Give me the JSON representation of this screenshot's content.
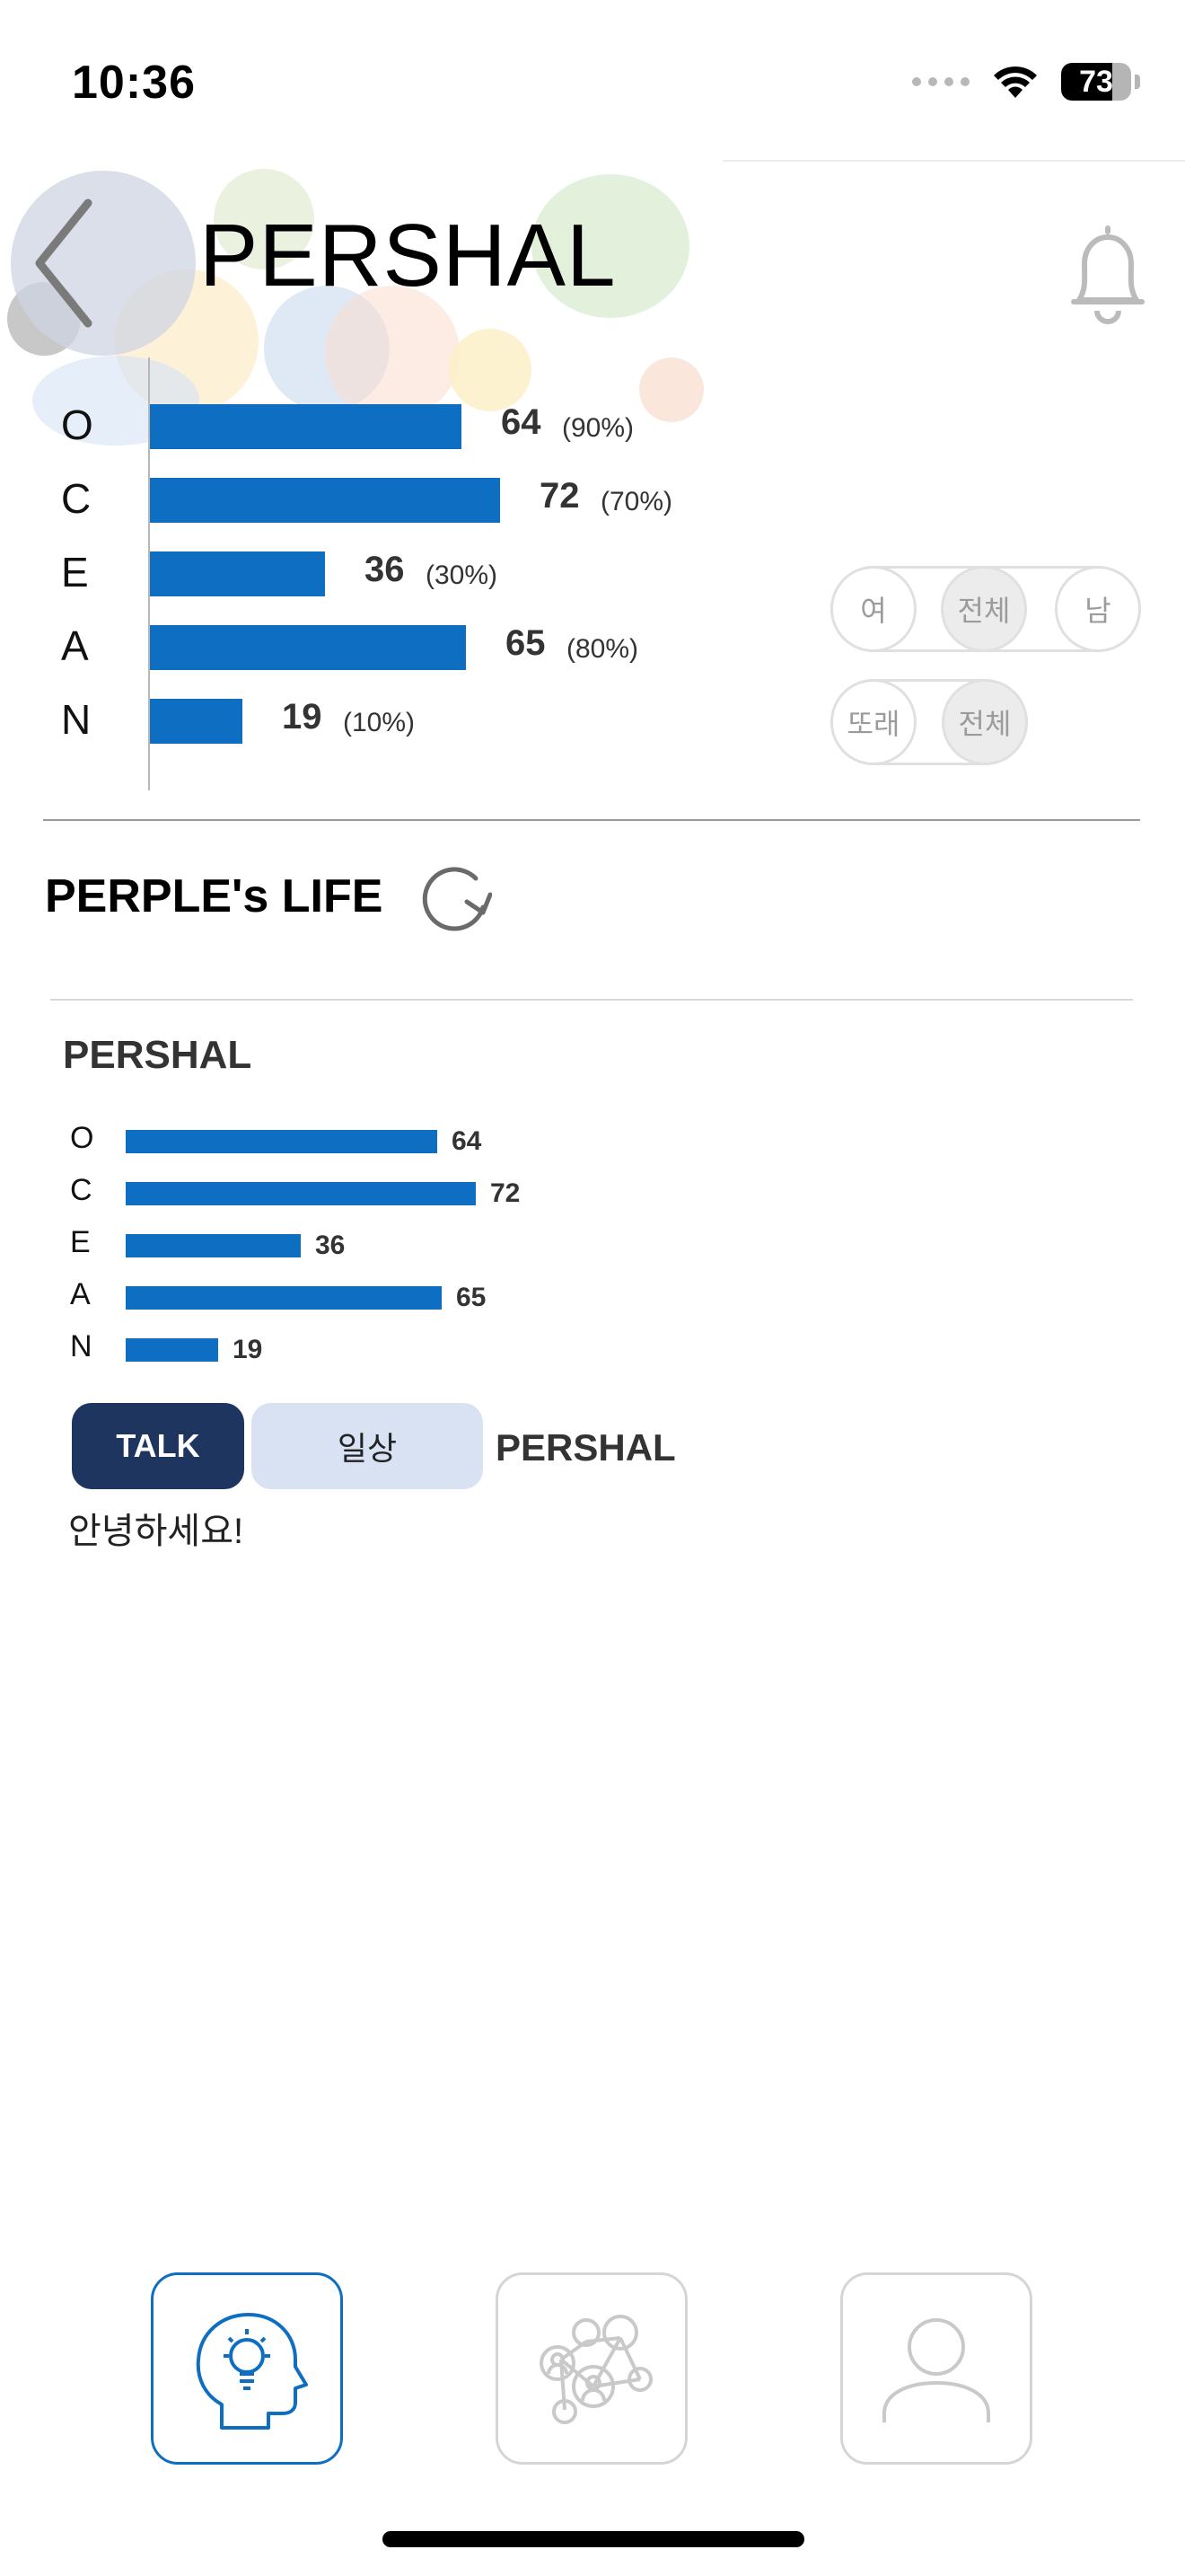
{
  "status_bar": {
    "time": "10:36",
    "battery_level": "73",
    "battery_fraction": 0.73
  },
  "header": {
    "title": "PERSHAL",
    "back_icon": "chevron-left-icon",
    "bell_icon": "bell-icon"
  },
  "ocean_chart": {
    "rows": [
      {
        "letter": "O",
        "value": "64",
        "percent": "(90%)",
        "v": 64
      },
      {
        "letter": "C",
        "value": "72",
        "percent": "(70%)",
        "v": 72
      },
      {
        "letter": "E",
        "value": "36",
        "percent": "(30%)",
        "v": 36
      },
      {
        "letter": "A",
        "value": "65",
        "percent": "(80%)",
        "v": 65
      },
      {
        "letter": "N",
        "value": "19",
        "percent": "(10%)",
        "v": 19
      }
    ],
    "bar_color": "#0e6fc2"
  },
  "filters": {
    "gender": {
      "options": [
        "여",
        "전체",
        "남"
      ],
      "selected": "전체"
    },
    "age": {
      "options": [
        "또래",
        "전체"
      ],
      "selected": "전체"
    }
  },
  "life_section": {
    "title": "PERPLE's LIFE",
    "refresh_icon": "refresh-icon"
  },
  "card": {
    "title": "PERSHAL",
    "rows": [
      {
        "letter": "O",
        "value": "64",
        "v": 64
      },
      {
        "letter": "C",
        "value": "72",
        "v": 72
      },
      {
        "letter": "E",
        "value": "36",
        "v": 36
      },
      {
        "letter": "A",
        "value": "65",
        "v": 65
      },
      {
        "letter": "N",
        "value": "19",
        "v": 19
      }
    ],
    "tag_talk": "TALK",
    "tag_daily": "일상",
    "author": "PERSHAL",
    "message": "안녕하세요!"
  },
  "bottom_nav": {
    "items": [
      {
        "icon": "head-lightbulb-icon",
        "active": true
      },
      {
        "icon": "network-people-icon",
        "active": false
      },
      {
        "icon": "person-profile-icon",
        "active": false
      }
    ],
    "active_color": "#0e6fc2",
    "inactive_color": "#d5d5d5"
  }
}
